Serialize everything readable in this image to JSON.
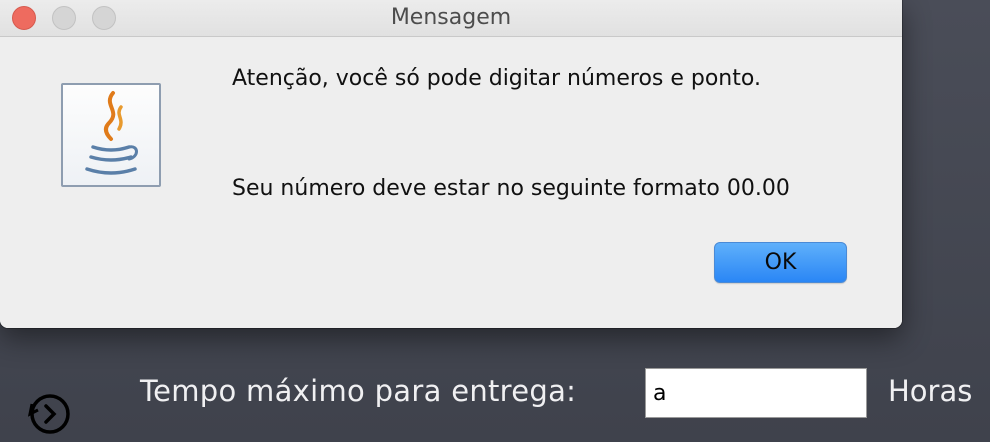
{
  "dialog": {
    "title": "Mensagem",
    "message_line1": "Atenção, você só pode digitar números e ponto.",
    "message_line2": "Seu número deve estar no seguinte formato 00.00",
    "ok_label": "OK",
    "icon": "java-icon"
  },
  "background": {
    "field_label": "Tempo máximo para entrega:",
    "field_value": "a",
    "field_units": "Horas",
    "icon": "history-icon"
  },
  "colors": {
    "close_button": "#ee6b5f",
    "ok_button": "#2a86f5",
    "background": "#484b55"
  }
}
